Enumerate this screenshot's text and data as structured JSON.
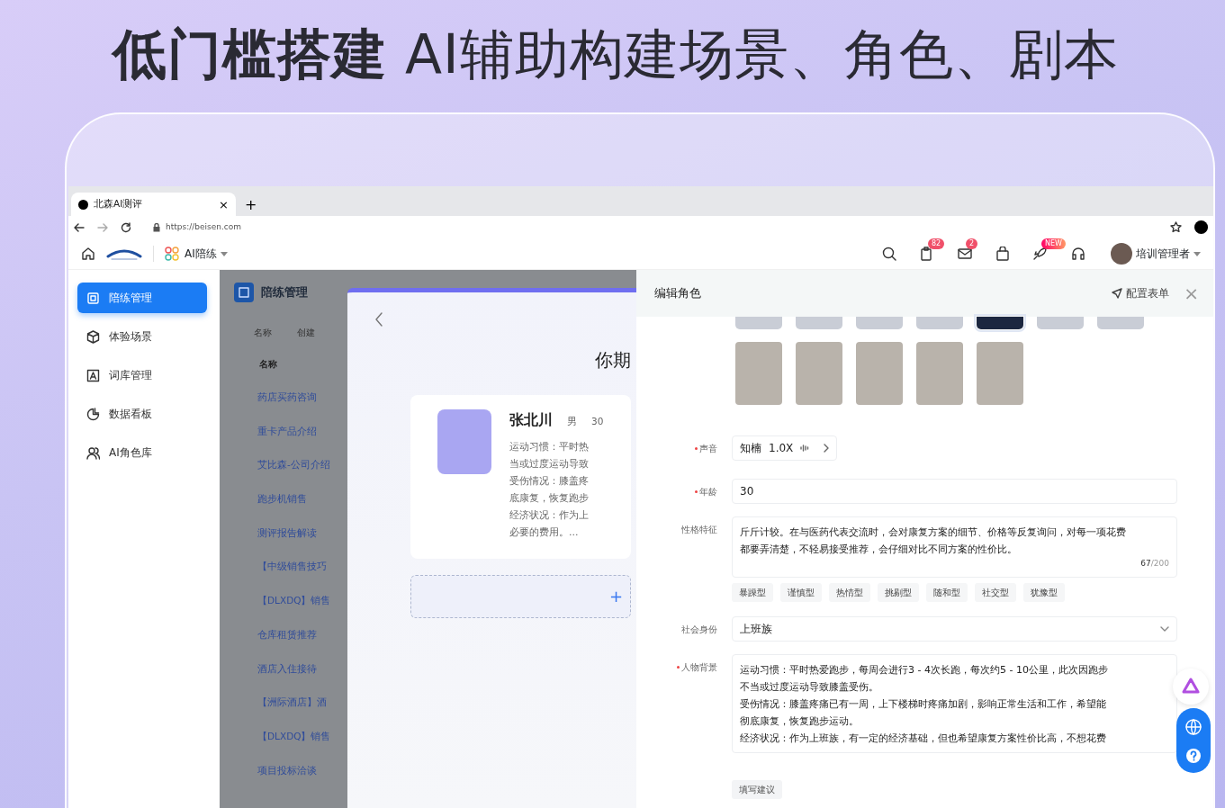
{
  "headline": "**低门槛搭建** AI辅助构建场景、角色、剧本",
  "browser": {
    "tab_title": "北森AI测评",
    "tab_close": "×",
    "new_tab": "+",
    "url": "https://beisen.com"
  },
  "app_header": {
    "module": "AI陪练",
    "user": "培训管理者",
    "tools": [
      {
        "kind": "search"
      },
      {
        "kind": "clipboard",
        "badge": "82"
      },
      {
        "kind": "mail",
        "badge": "2"
      },
      {
        "kind": "bag"
      },
      {
        "kind": "rocket",
        "badge": "NEW"
      },
      {
        "kind": "headset"
      }
    ]
  },
  "sidebar": {
    "items": [
      {
        "label": "陪练管理",
        "selected": true
      },
      {
        "label": "体验场景",
        "selected": false
      },
      {
        "label": "词库管理",
        "selected": false
      },
      {
        "label": "数据看板",
        "selected": false
      },
      {
        "label": "AI角色库",
        "selected": false
      }
    ]
  },
  "list": {
    "title": "陪练管理",
    "filters": [
      "名称",
      "创建"
    ],
    "column": "名称",
    "rows": [
      "药店买药咨询",
      "重卡产品介绍",
      "艾比森-公司介绍",
      "跑步机销售",
      "测评报告解读",
      "【中级销售技巧",
      "【DLXDQ】销售",
      "仓库租赁推荐",
      "酒店入住接待",
      "【洲际酒店】酒",
      "【DLXDQ】销售",
      "项目投标洽谈"
    ]
  },
  "modal": {
    "heading": "你期",
    "add": "+",
    "card": {
      "name": "张北川",
      "gender": "男",
      "age": "30",
      "lines": [
        "运动习惯：平时热",
        "当或过度运动导致",
        "受伤情况：膝盖疼",
        "底康复，恢复跑步",
        "经济状况：作为上",
        "必要的费用。..."
      ]
    }
  },
  "drawer": {
    "title": "编辑角色",
    "config": "配置表单",
    "close": "×",
    "avatars_top": [
      {
        "selected": false
      },
      {
        "selected": false
      },
      {
        "selected": false
      },
      {
        "selected": false
      },
      {
        "selected": true
      },
      {
        "selected": false
      },
      {
        "selected": false
      }
    ],
    "avatars": [
      {
        "selected": false
      },
      {
        "selected": false
      },
      {
        "selected": false
      },
      {
        "selected": false
      },
      {
        "selected": false
      }
    ],
    "fields": [
      {
        "kind": "voice",
        "label": "声音",
        "required": true,
        "voice": "知楠",
        "speed": "1.0X"
      },
      {
        "kind": "input",
        "label": "年龄",
        "required": true,
        "value": "30"
      },
      {
        "kind": "textarea",
        "label": "性格特征",
        "required": false,
        "lines": [
          "斤斤计较。在与医药代表交流时，会对康复方案的细节、价格等反复询问，对每一项花费",
          "都要弄清楚，不轻易接受推荐，会仔细对比不同方案的性价比。"
        ],
        "count": "67",
        "max": "/200",
        "tags": [
          "暴躁型",
          "谨慎型",
          "热情型",
          "挑剔型",
          "随和型",
          "社交型",
          "犹豫型"
        ]
      },
      {
        "kind": "select",
        "label": "社会身份",
        "required": false,
        "value": "上班族"
      },
      {
        "kind": "textarea",
        "label": "人物背景",
        "required": true,
        "lines": [
          "运动习惯：平时热爱跑步，每周会进行3 - 4次长跑，每次约5 - 10公里，此次因跑步",
          "不当或过度运动导致膝盖受伤。",
          "受伤情况：膝盖疼痛已有一周，上下楼梯时疼痛加剧，影响正常生活和工作，希望能",
          "彻底康复，恢复跑步运动。",
          "经济状况：作为上班族，有一定的经济基础，但也希望康复方案性价比高，不想花费"
        ]
      }
    ],
    "suggest": "填写建议"
  }
}
